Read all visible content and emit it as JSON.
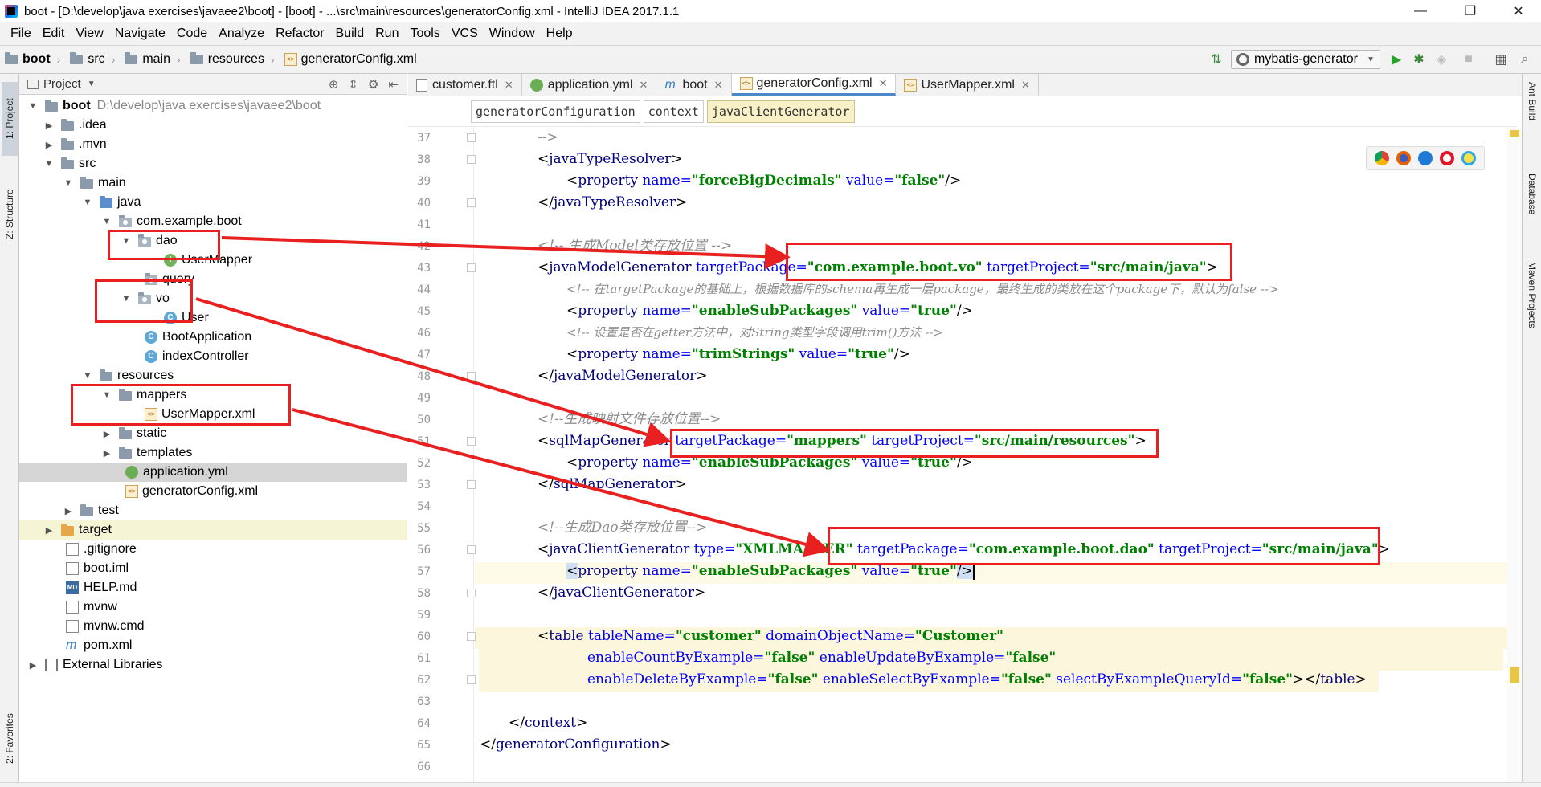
{
  "window": {
    "title": "boot - [D:\\develop\\java exercises\\javaee2\\boot] - [boot] - ...\\src\\main\\resources\\generatorConfig.xml - IntelliJ IDEA 2017.1.1",
    "minimize": "—",
    "maximize": "❐",
    "close": "✕"
  },
  "menu": [
    "File",
    "Edit",
    "View",
    "Navigate",
    "Code",
    "Analyze",
    "Refactor",
    "Build",
    "Run",
    "Tools",
    "VCS",
    "Window",
    "Help"
  ],
  "breadcrumb": [
    "boot",
    "src",
    "main",
    "resources",
    "generatorConfig.xml"
  ],
  "run_config": "mybatis-generator",
  "left_tabs": [
    "1: Project",
    "Z: Structure",
    "2: Favorites"
  ],
  "right_tabs": [
    "Ant Build",
    "Database",
    "Maven Projects"
  ],
  "project_panel": {
    "title": "Project",
    "rows": [
      {
        "label": "boot",
        "extra": "D:\\develop\\java exercises\\javaee2\\boot"
      },
      {
        "label": ".idea"
      },
      {
        "label": ".mvn"
      },
      {
        "label": "src"
      },
      {
        "label": "main"
      },
      {
        "label": "java"
      },
      {
        "label": "com.example.boot"
      },
      {
        "label": "dao"
      },
      {
        "label": "UserMapper"
      },
      {
        "label": "query"
      },
      {
        "label": "vo"
      },
      {
        "label": "User"
      },
      {
        "label": "BootApplication"
      },
      {
        "label": "indexController"
      },
      {
        "label": "resources"
      },
      {
        "label": "mappers"
      },
      {
        "label": "UserMapper.xml"
      },
      {
        "label": "static"
      },
      {
        "label": "templates"
      },
      {
        "label": "application.yml"
      },
      {
        "label": "generatorConfig.xml"
      },
      {
        "label": "test"
      },
      {
        "label": "target"
      },
      {
        "label": ".gitignore"
      },
      {
        "label": "boot.iml"
      },
      {
        "label": "HELP.md"
      },
      {
        "label": "mvnw"
      },
      {
        "label": "mvnw.cmd"
      },
      {
        "label": "pom.xml"
      },
      {
        "label": "External Libraries"
      }
    ]
  },
  "editor_tabs": [
    "customer.ftl",
    "application.yml",
    "boot",
    "generatorConfig.xml",
    "UserMapper.xml"
  ],
  "xml_breadcrumb": [
    "generatorConfiguration",
    "context",
    "javaClientGenerator"
  ],
  "line_numbers": [
    "37",
    "38",
    "39",
    "40",
    "41",
    "42",
    "43",
    "44",
    "45",
    "46",
    "47",
    "48",
    "49",
    "50",
    "51",
    "52",
    "53",
    "54",
    "55",
    "56",
    "57",
    "58",
    "59",
    "60",
    "61",
    "62",
    "63",
    "64",
    "65",
    "66"
  ],
  "code": {
    "l37": "-->",
    "l38": "javaTypeResolver",
    "l39_tag": "property",
    "l39_a1": "name=",
    "l39_v1": "\"forceBigDecimals\"",
    "l39_a2": "value=",
    "l39_v2": "\"false\"",
    "l40": "javaTypeResolver",
    "l42": "<!-- 生成Model类存放位置 -->",
    "l43_tag": "javaModelGenerator",
    "l43_a1": "targetPackage=",
    "l43_v1": "\"com.example.boot.vo\"",
    "l43_a2": "targetProject=",
    "l43_v2": "\"src/main/java\"",
    "l44": "<!-- 在targetPackage的基础上，根据数据库的schema再生成一层package，最终生成的类放在这个package下，默认为false -->",
    "l45_tag": "property",
    "l45_a1": "name=",
    "l45_v1": "\"enableSubPackages\"",
    "l45_a2": "value=",
    "l45_v2": "\"true\"",
    "l46": "<!-- 设置是否在getter方法中，对String类型字段调用trim()方法 -->",
    "l47_tag": "property",
    "l47_a1": "name=",
    "l47_v1": "\"trimStrings\"",
    "l47_a2": "value=",
    "l47_v2": "\"true\"",
    "l48": "javaModelGenerator",
    "l50": "<!--生成映射文件存放位置-->",
    "l51_tag": "sqlMapGenerator",
    "l51_a1": "targetPackage=",
    "l51_v1": "\"mappers\"",
    "l51_a2": "targetProject=",
    "l51_v2": "\"src/main/resources\"",
    "l52_tag": "property",
    "l52_a1": "name=",
    "l52_v1": "\"enableSubPackages\"",
    "l52_a2": "value=",
    "l52_v2": "\"true\"",
    "l53": "sqlMapGenerator",
    "l55": "<!--生成Dao类存放位置-->",
    "l56_tag": "javaClientGenerator",
    "l56_a0": "type=",
    "l56_v0": "\"XMLMAPPER\"",
    "l56_a1": "targetPackage=",
    "l56_v1": "\"com.example.boot.dao\"",
    "l56_a2": "targetProject=",
    "l56_v2": "\"src/main/java\"",
    "l57_tag": "property",
    "l57_a1": "name=",
    "l57_v1": "\"enableSubPackages\"",
    "l57_a2": "value=",
    "l57_v2": "\"true\"",
    "l58": "javaClientGenerator",
    "l60_tag": "table",
    "l60_a1": "tableName=",
    "l60_v1": "\"customer\"",
    "l60_a2": "domainObjectName=",
    "l60_v2": "\"Customer\"",
    "l61_a1": "enableCountByExample=",
    "l61_v1": "\"false\"",
    "l61_a2": "enableUpdateByExample=",
    "l61_v2": "\"false\"",
    "l62_a1": "enableDeleteByExample=",
    "l62_v1": "\"false\"",
    "l62_a2": "enableSelectByExample=",
    "l62_v2": "\"false\"",
    "l62_a3": "selectByExampleQueryId=",
    "l62_v3": "\"false\"",
    "l62_close": "table",
    "l64": "context",
    "l65": "generatorConfiguration"
  },
  "colors": {
    "annotation_red": "#e82020",
    "tag_blue": "#000080",
    "attr_blue": "#0000ff",
    "value_green": "#008000",
    "comment_gray": "#8c8c8c"
  }
}
